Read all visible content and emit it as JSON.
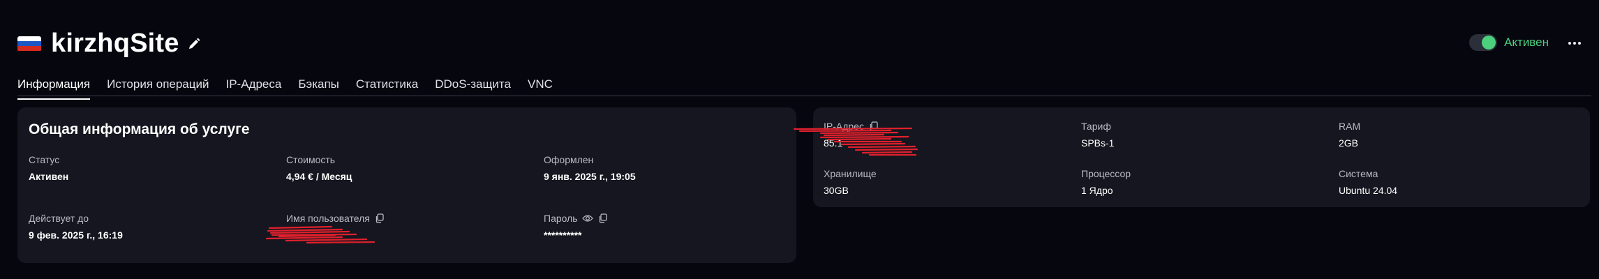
{
  "header": {
    "title": "kirzhqSite",
    "status_label": "Активен",
    "status_color": "#4cd07d",
    "flag_icon": "russia-flag-icon",
    "edit_icon": "pencil-icon",
    "more_icon": "more-dots-icon"
  },
  "tabs": [
    {
      "label": "Информация",
      "active": true
    },
    {
      "label": "История операций",
      "active": false
    },
    {
      "label": "IP-Адреса",
      "active": false
    },
    {
      "label": "Бэкапы",
      "active": false
    },
    {
      "label": "Статистика",
      "active": false
    },
    {
      "label": "DDoS-защита",
      "active": false
    },
    {
      "label": "VNC",
      "active": false
    }
  ],
  "service": {
    "title": "Общая информация об услуге",
    "status": {
      "label": "Статус",
      "value": "Активен"
    },
    "cost": {
      "label": "Стоимость",
      "value": "4,94 € / Месяц"
    },
    "created": {
      "label": "Оформлен",
      "value": "9 янв. 2025 г., 19:05"
    },
    "valid_until": {
      "label": "Действует до",
      "value": "9 фев. 2025 г., 16:19"
    },
    "username": {
      "label": "Имя пользователя",
      "value": ""
    },
    "password": {
      "label": "Пароль",
      "value": "**********"
    }
  },
  "specs": {
    "ip": {
      "label": "IP-Адрес",
      "value": "85.1"
    },
    "tariff": {
      "label": "Тариф",
      "value": "SPBs-1"
    },
    "ram": {
      "label": "RAM",
      "value": "2GB"
    },
    "storage": {
      "label": "Хранилище",
      "value": "30GB"
    },
    "cpu": {
      "label": "Процессор",
      "value": "1 Ядро"
    },
    "os": {
      "label": "Система",
      "value": "Ubuntu 24.04"
    }
  }
}
